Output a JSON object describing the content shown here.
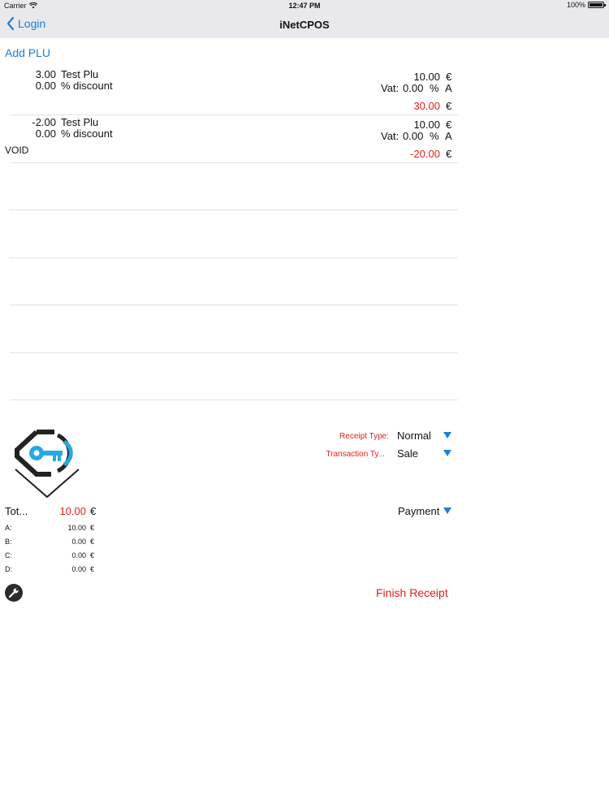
{
  "status_bar": {
    "carrier": "Carrier",
    "time": "12:47 PM",
    "battery": "100%"
  },
  "nav": {
    "back_label": "Login",
    "title": "iNetCPOS"
  },
  "add_plu_label": "Add PLU",
  "items": [
    {
      "qty": "3.00",
      "name": "Test Plu",
      "discount": "0.00",
      "discount_label": "% discount",
      "price": "10.00",
      "currency": "€",
      "vat_label": "Vat:",
      "vat": "0.00",
      "vat_unit": "%",
      "vat_class": "A",
      "total": "30.00",
      "status": ""
    },
    {
      "qty": "-2.00",
      "name": "Test Plu",
      "discount": "0.00",
      "discount_label": "% discount",
      "price": "10.00",
      "currency": "€",
      "vat_label": "Vat:",
      "vat": "0.00",
      "vat_unit": "%",
      "vat_class": "A",
      "total": "-20.00",
      "status": "VOID"
    }
  ],
  "receipt_type": {
    "label": "Receipt Type:",
    "value": "Normal"
  },
  "transaction_type": {
    "label": "Transaction Ty...",
    "value": "Sale"
  },
  "totals": {
    "label": "Tot...",
    "value": "10.00",
    "currency": "€",
    "vat_rows": [
      {
        "label": "A:",
        "value": "10.00",
        "currency": "€"
      },
      {
        "label": "B:",
        "value": "0.00",
        "currency": "€"
      },
      {
        "label": "C:",
        "value": "0.00",
        "currency": "€"
      },
      {
        "label": "D:",
        "value": "0.00",
        "currency": "€"
      }
    ]
  },
  "payment_label": "Payment",
  "finish_label": "Finish Receipt",
  "colors": {
    "accent": "#1a7fd6",
    "red": "#e0201b",
    "bar": "#e9e9ed"
  },
  "icons": [
    "wifi-icon",
    "battery-icon",
    "chevron-left-icon",
    "logo-icon",
    "dropdown-triangle-icon",
    "wrench-icon"
  ]
}
